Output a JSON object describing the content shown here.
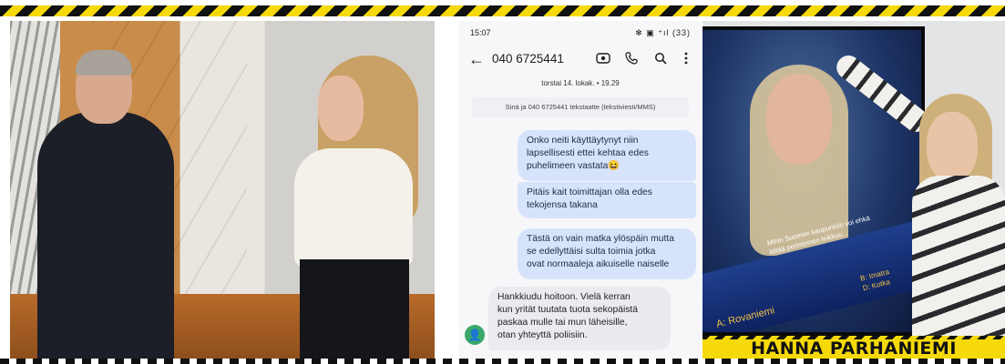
{
  "phone": {
    "status_time": "15:07",
    "status_icons": "✻ ▣ ⁺ıl (33)",
    "contact_number": "040 6725441",
    "date_line": "torstai 14. lokak. • 19.29",
    "info_text": "Sinä ja 040 6725441 tekstaatte (tekstiviesti/MMS)",
    "avatar_glyph": "👤",
    "messages": [
      {
        "direction": "sent",
        "text": "Onko neiti käyttäytynyt niin\nlapsellisesti ettei kehtaa edes\npuhelimeen vastata😆"
      },
      {
        "direction": "sent",
        "text": "Pitäis kait toimittajan olla edes\ntekojensa takana"
      },
      {
        "direction": "sent",
        "text": "Tästä on vain matka ylöspäin mutta\nse edellyttäisi sulta toimia jotka\novat normaaleja aikuiselle naiselle"
      },
      {
        "direction": "received",
        "text": "Hankkiudu hoitoon. Vielä kerran\nkun yrität tuutata tuota sekopäistä\npaskaa mulle tai mun läheisille,\notan yhteyttä poliisiin."
      }
    ],
    "icons": [
      "back-arrow-icon",
      "video-call-icon",
      "phone-icon",
      "search-icon",
      "more-vert-icon"
    ]
  },
  "tv": {
    "question": "Mihin Suomen kaupunkiin voi ehkä\nliittää perinteinen leikkuu...",
    "answer_a": "A: Rovaniemi",
    "answer_b": "B: Imatra\nD: Kotka"
  },
  "banner": {
    "name": "HANNA PARHANIEMI"
  },
  "colors": {
    "hazard_yellow": "#f5d90a",
    "sent_bubble": "#d6e3fb",
    "received_bubble": "#e9ebef",
    "avatar_green": "#3aa86b"
  }
}
